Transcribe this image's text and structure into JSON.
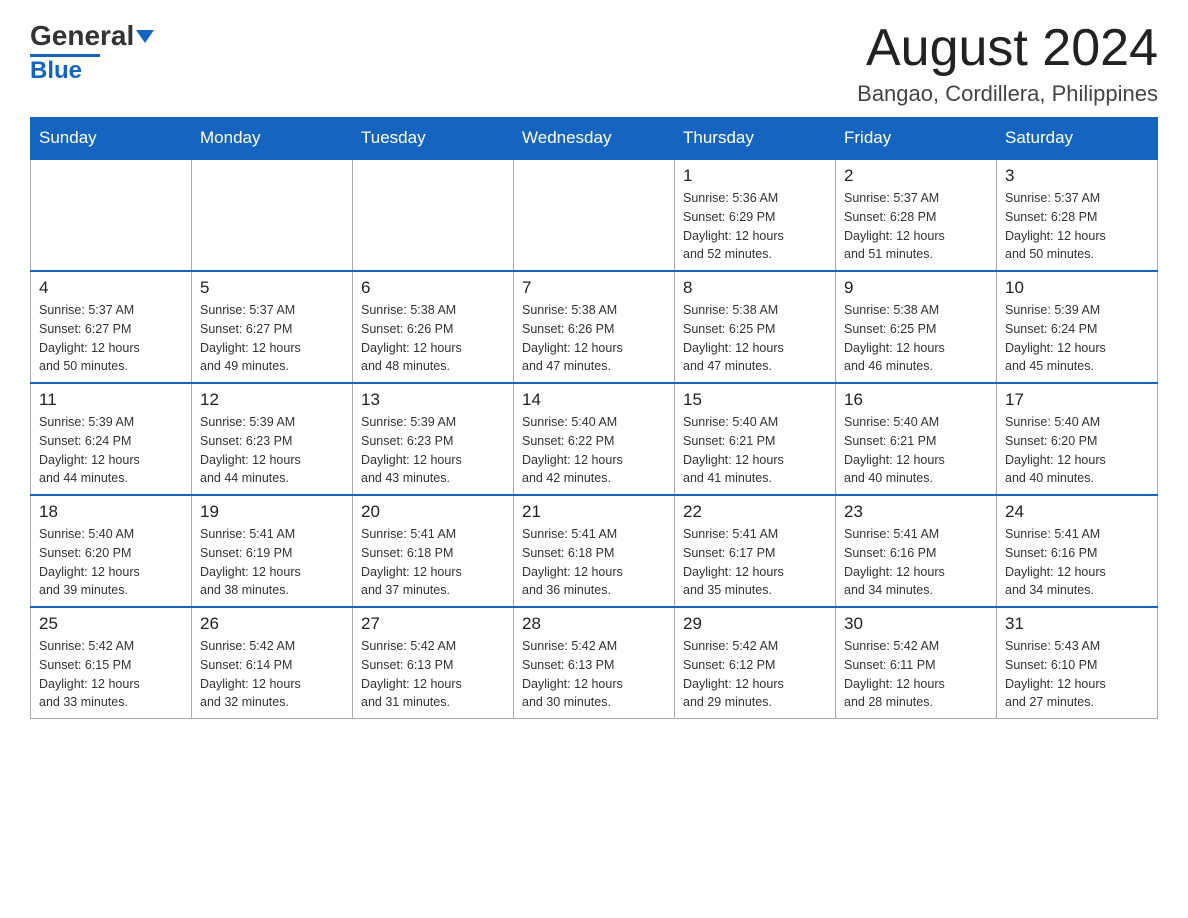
{
  "header": {
    "logo_text_main": "General",
    "logo_text_blue": "Blue",
    "month_title": "August 2024",
    "location": "Bangao, Cordillera, Philippines"
  },
  "days_of_week": [
    "Sunday",
    "Monday",
    "Tuesday",
    "Wednesday",
    "Thursday",
    "Friday",
    "Saturday"
  ],
  "weeks": [
    [
      {
        "day": "",
        "info": ""
      },
      {
        "day": "",
        "info": ""
      },
      {
        "day": "",
        "info": ""
      },
      {
        "day": "",
        "info": ""
      },
      {
        "day": "1",
        "info": "Sunrise: 5:36 AM\nSunset: 6:29 PM\nDaylight: 12 hours\nand 52 minutes."
      },
      {
        "day": "2",
        "info": "Sunrise: 5:37 AM\nSunset: 6:28 PM\nDaylight: 12 hours\nand 51 minutes."
      },
      {
        "day": "3",
        "info": "Sunrise: 5:37 AM\nSunset: 6:28 PM\nDaylight: 12 hours\nand 50 minutes."
      }
    ],
    [
      {
        "day": "4",
        "info": "Sunrise: 5:37 AM\nSunset: 6:27 PM\nDaylight: 12 hours\nand 50 minutes."
      },
      {
        "day": "5",
        "info": "Sunrise: 5:37 AM\nSunset: 6:27 PM\nDaylight: 12 hours\nand 49 minutes."
      },
      {
        "day": "6",
        "info": "Sunrise: 5:38 AM\nSunset: 6:26 PM\nDaylight: 12 hours\nand 48 minutes."
      },
      {
        "day": "7",
        "info": "Sunrise: 5:38 AM\nSunset: 6:26 PM\nDaylight: 12 hours\nand 47 minutes."
      },
      {
        "day": "8",
        "info": "Sunrise: 5:38 AM\nSunset: 6:25 PM\nDaylight: 12 hours\nand 47 minutes."
      },
      {
        "day": "9",
        "info": "Sunrise: 5:38 AM\nSunset: 6:25 PM\nDaylight: 12 hours\nand 46 minutes."
      },
      {
        "day": "10",
        "info": "Sunrise: 5:39 AM\nSunset: 6:24 PM\nDaylight: 12 hours\nand 45 minutes."
      }
    ],
    [
      {
        "day": "11",
        "info": "Sunrise: 5:39 AM\nSunset: 6:24 PM\nDaylight: 12 hours\nand 44 minutes."
      },
      {
        "day": "12",
        "info": "Sunrise: 5:39 AM\nSunset: 6:23 PM\nDaylight: 12 hours\nand 44 minutes."
      },
      {
        "day": "13",
        "info": "Sunrise: 5:39 AM\nSunset: 6:23 PM\nDaylight: 12 hours\nand 43 minutes."
      },
      {
        "day": "14",
        "info": "Sunrise: 5:40 AM\nSunset: 6:22 PM\nDaylight: 12 hours\nand 42 minutes."
      },
      {
        "day": "15",
        "info": "Sunrise: 5:40 AM\nSunset: 6:21 PM\nDaylight: 12 hours\nand 41 minutes."
      },
      {
        "day": "16",
        "info": "Sunrise: 5:40 AM\nSunset: 6:21 PM\nDaylight: 12 hours\nand 40 minutes."
      },
      {
        "day": "17",
        "info": "Sunrise: 5:40 AM\nSunset: 6:20 PM\nDaylight: 12 hours\nand 40 minutes."
      }
    ],
    [
      {
        "day": "18",
        "info": "Sunrise: 5:40 AM\nSunset: 6:20 PM\nDaylight: 12 hours\nand 39 minutes."
      },
      {
        "day": "19",
        "info": "Sunrise: 5:41 AM\nSunset: 6:19 PM\nDaylight: 12 hours\nand 38 minutes."
      },
      {
        "day": "20",
        "info": "Sunrise: 5:41 AM\nSunset: 6:18 PM\nDaylight: 12 hours\nand 37 minutes."
      },
      {
        "day": "21",
        "info": "Sunrise: 5:41 AM\nSunset: 6:18 PM\nDaylight: 12 hours\nand 36 minutes."
      },
      {
        "day": "22",
        "info": "Sunrise: 5:41 AM\nSunset: 6:17 PM\nDaylight: 12 hours\nand 35 minutes."
      },
      {
        "day": "23",
        "info": "Sunrise: 5:41 AM\nSunset: 6:16 PM\nDaylight: 12 hours\nand 34 minutes."
      },
      {
        "day": "24",
        "info": "Sunrise: 5:41 AM\nSunset: 6:16 PM\nDaylight: 12 hours\nand 34 minutes."
      }
    ],
    [
      {
        "day": "25",
        "info": "Sunrise: 5:42 AM\nSunset: 6:15 PM\nDaylight: 12 hours\nand 33 minutes."
      },
      {
        "day": "26",
        "info": "Sunrise: 5:42 AM\nSunset: 6:14 PM\nDaylight: 12 hours\nand 32 minutes."
      },
      {
        "day": "27",
        "info": "Sunrise: 5:42 AM\nSunset: 6:13 PM\nDaylight: 12 hours\nand 31 minutes."
      },
      {
        "day": "28",
        "info": "Sunrise: 5:42 AM\nSunset: 6:13 PM\nDaylight: 12 hours\nand 30 minutes."
      },
      {
        "day": "29",
        "info": "Sunrise: 5:42 AM\nSunset: 6:12 PM\nDaylight: 12 hours\nand 29 minutes."
      },
      {
        "day": "30",
        "info": "Sunrise: 5:42 AM\nSunset: 6:11 PM\nDaylight: 12 hours\nand 28 minutes."
      },
      {
        "day": "31",
        "info": "Sunrise: 5:43 AM\nSunset: 6:10 PM\nDaylight: 12 hours\nand 27 minutes."
      }
    ]
  ]
}
